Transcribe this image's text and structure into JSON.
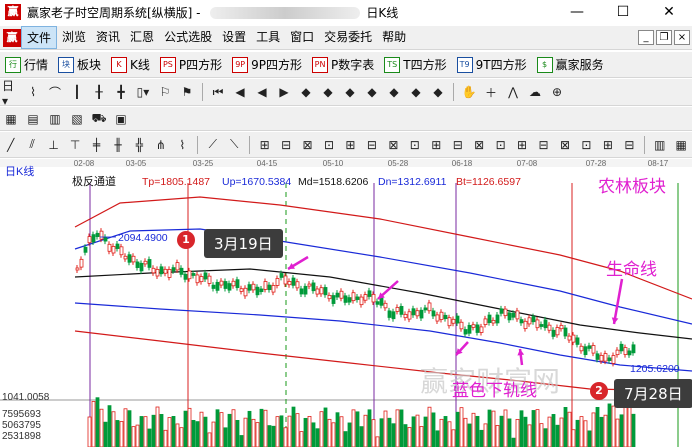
{
  "window": {
    "app_icon": "赢",
    "title_prefix": "赢家老子时空周期系统[纵横版] - ",
    "title_suffix": "日K线"
  },
  "menu": {
    "logo": "赢",
    "items": [
      "文件",
      "浏览",
      "资讯",
      "汇恩",
      "公式选股",
      "设置",
      "工具",
      "窗口",
      "交易委托",
      "帮助"
    ]
  },
  "toolbar1": [
    {
      "icon": "行",
      "label": "行情"
    },
    {
      "icon": "块",
      "label": "板块"
    },
    {
      "icon": "K",
      "label": "K线"
    },
    {
      "icon": "PS",
      "label": "P四方形"
    },
    {
      "icon": "9P",
      "label": "9P四方形"
    },
    {
      "icon": "PN",
      "label": "P数字表"
    },
    {
      "icon": "TS",
      "label": "T四方形"
    },
    {
      "icon": "T9",
      "label": "9T四方形"
    },
    {
      "icon": "$",
      "label": "赢家服务"
    }
  ],
  "chart": {
    "period": "日K线",
    "indicator_name": "极反通道",
    "tp": "Tp=1805.1487",
    "up": "Up=1670.5384",
    "md": "Md=1518.6206",
    "dn": "Dn=1312.6911",
    "bt": "Bt=1126.6597",
    "date_labels": [
      "02-08",
      "03-05",
      "03-25",
      "04-15",
      "05-10",
      "05-28",
      "06-18",
      "07-08",
      "07-28",
      "08-17"
    ],
    "high_price": "2094.4900",
    "low_price": "1205.6200",
    "axis_low": "1041.0058",
    "vol_labels": [
      "7595693",
      "5063795",
      "2531898"
    ],
    "watermark": "赢家财富网"
  },
  "annotations": {
    "sector": "农林板块",
    "life_line": "生命线",
    "lower_rail": "蓝色下轨线",
    "callout1": "3月19日",
    "callout2": "7月28日",
    "badge1": "1",
    "badge2": "2"
  },
  "colors": {
    "up_candle": "#e0201a",
    "down_candle": "#009a3a",
    "outer_band": "#d21a1a",
    "mid_band": "#1a2ad8",
    "center_line": "#111111",
    "cycle_line_red": "#d82020",
    "cycle_line_purple": "#7a2aa0",
    "cycle_line_green": "#1a9a1a",
    "annotation": "#e020d0"
  }
}
